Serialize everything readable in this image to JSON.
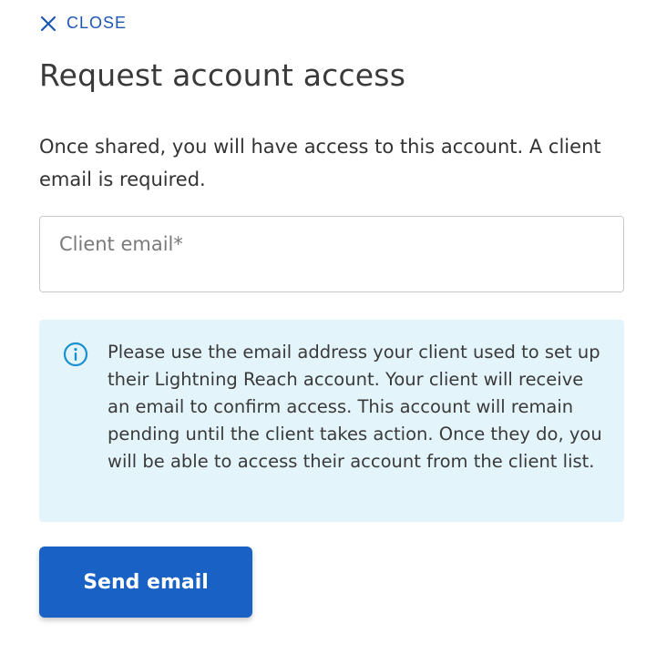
{
  "header": {
    "close_label": "CLOSE"
  },
  "dialog": {
    "title": "Request account access",
    "subtitle": "Once shared, you will have access to this account. A client email is required."
  },
  "form": {
    "email_placeholder": "Client email",
    "email_required_marker": "*",
    "email_value": ""
  },
  "info": {
    "icon": "info-icon",
    "message": "Please use the email address your client used to set up their Lightning Reach account. Your client will receive an email to confirm access. This account will remain pending until the client takes action. Once they do, you will be able to access their account from the client list."
  },
  "actions": {
    "send_label": "Send email"
  },
  "colors": {
    "primary": "#1961c4",
    "link": "#1e56b4",
    "info_bg": "#e3f4fa",
    "info_icon": "#1a8fd1"
  }
}
